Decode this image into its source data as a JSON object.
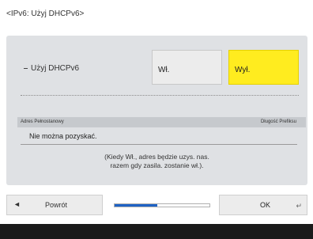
{
  "screen": {
    "title": "<IPv6: Użyj DHCPv6>"
  },
  "setting": {
    "label": "Użyj DHCPv6",
    "option_on": "Wł.",
    "option_off": "Wył."
  },
  "info_table": {
    "header_left": "Adres Pełnostanowy",
    "header_right": "Długość Prefiksu",
    "value": "Nie można pozyskać."
  },
  "note": {
    "line1": "(Kiedy Wł., adres będzie uzys. nas.",
    "line2": "razem gdy zasila. zostanie wł.)."
  },
  "footer": {
    "back_arrow": "◄",
    "back_label": "Powrót",
    "progress_fraction": 0.45,
    "ok_label": "OK",
    "enter_icon": "↵"
  },
  "colors": {
    "selected": "#ffec1f",
    "progress": "#1e62c4"
  }
}
